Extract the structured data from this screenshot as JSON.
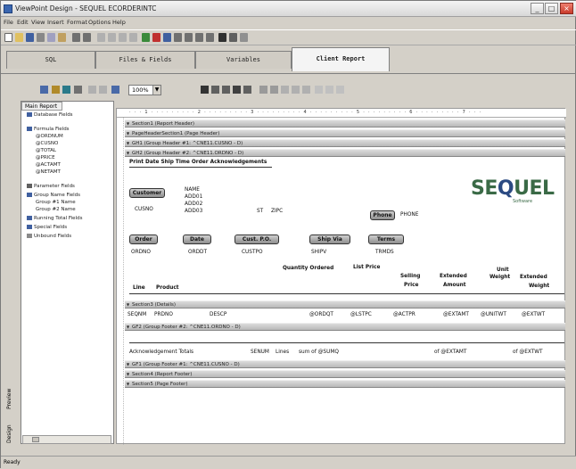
{
  "window": {
    "title": "ViewPoint Design - SEQUEL ECORDERINTC",
    "min": "_",
    "max": "□",
    "close": "×"
  },
  "menu": [
    "File",
    "Edit",
    "View",
    "Insert",
    "Format",
    "Options",
    "Help"
  ],
  "tabs": [
    {
      "label": "SQL",
      "active": false
    },
    {
      "label": "Files & Fields",
      "active": false
    },
    {
      "label": "Variables",
      "active": false
    },
    {
      "label": "Client Report",
      "active": true
    }
  ],
  "report_toolbar": {
    "zoom": "100%"
  },
  "left_panel": {
    "tab": "Main Report",
    "tree": [
      "Database Fields",
      "Formula Fields",
      "@ORDNUM",
      "@CUSNO",
      "@TOTAL",
      "@PRICE",
      "@ACTAMT",
      "@NETAMT",
      "Parameter Fields",
      "Group Name Fields",
      "Group #1 Name",
      "Group #2 Name",
      "Running Total Fields",
      "Special Fields",
      "Unbound Fields"
    ],
    "vtabs": [
      "Design",
      "Preview"
    ]
  },
  "report": {
    "ruler": "· · · 1 · · · · · · · · · 2 · · · · · · · · · 3 · · · · · · · · · 4 · · · · · · · · · 5 · · · · · · · · · 6 · · · · · · · · · 7 · · ·",
    "sections": {
      "s1": "Section1 (Report Header)",
      "s2": "PageHeaderSection1 (Page Header)",
      "s3": "GH1 (Group Header #1: ^CNE11.CUSNO - D)",
      "s4": "GH2 (Group Header #2: ^CNE11.ORDNO - D)",
      "s5": "Section3 (Details)",
      "s6": "GF2 (Group Footer #2: ^CNE11.ORDNO - D)",
      "s7": "GF1 (Group Footer #1: ^CNE11.CUSNO - D)",
      "s8": "Section4 (Report Footer)",
      "s9": "Section5 (Page Footer)"
    },
    "header_title": "Print Date Ship Time Order Acknowledgements",
    "buttons": {
      "customer": "Customer",
      "phone": "Phone",
      "order": "Order",
      "date": "Date",
      "custpo": "Cust. P.O.",
      "shipvia": "Ship Via",
      "terms": "Terms"
    },
    "fields": {
      "cusno": "CUSNO",
      "name": "NAME",
      "addr1": "ADD01",
      "addr2": "ADD02",
      "addr3": "ADD03",
      "st": "ST",
      "zipc": "ZIPC",
      "phone": "PHONE",
      "ordno": "ORDNO",
      "ordt": "ORDDT",
      "custpo": "CUSTPO",
      "shipv": "SHIPV",
      "trmds": "TRMDS"
    },
    "col_headers": {
      "line": "Line",
      "product": "Product",
      "qty": "Quantity Ordered",
      "listprice": "List Price",
      "selling1": "Selling",
      "selling2": "Price",
      "ext1": "Extended",
      "ext2": "Amount",
      "unitw1": "Unit",
      "unitw2": "Weight",
      "extw1": "Extended",
      "extw2": "Weight"
    },
    "detail": {
      "seqnm": "SEQNM",
      "prdno": "PRDNO",
      "desc": "DESCP",
      "ordqt": "@ORDQT",
      "listp": "@LSTPC",
      "sellp": "@ACTPR",
      "extamt": "@EXTAMT",
      "unitwt": "@UNITWT",
      "extwt": "@EXTWT"
    },
    "footer": {
      "label": "Acknowledgement Totals",
      "lines_field": "SENUM",
      "lines_label": "Lines",
      "sumf": "sum of @SUMQ",
      "sumamt": "of @EXTAMT",
      "sumwt": "of @EXTWT"
    },
    "logo": {
      "text1": "SE",
      "q": "Q",
      "text2": "UEL",
      "sub": "Software"
    }
  },
  "status": "Ready"
}
